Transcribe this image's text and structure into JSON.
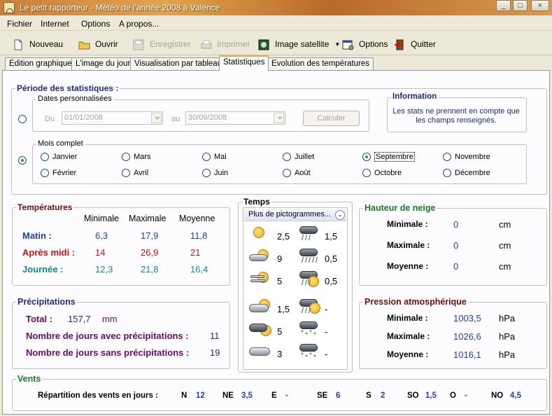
{
  "window": {
    "title": "Le petit rapporteur - Météo de l'année 2008 à Valence",
    "min": "_",
    "max": "□",
    "close": "×"
  },
  "menu": [
    "Fichier",
    "Internet",
    "Options",
    "A propos..."
  ],
  "toolbar": {
    "new": "Nouveau",
    "open": "Ouvrir",
    "save": "Enregistrer",
    "print": "Imprimer",
    "satellite": "Image satellite",
    "options": "Options",
    "quit": "Quitter"
  },
  "tabs": [
    "Edition graphique",
    "L'image du jour",
    "Visualisation par tableau",
    "Statistiques",
    "Evolution des températures"
  ],
  "period": {
    "title": "Période des statistiques :",
    "custom_title": "Dates personnalisées",
    "from_label": "Du",
    "from_value": "01/01/2008",
    "to_label": "au",
    "to_value": "30/09/2008",
    "compute": "Calculer",
    "month_title": "Mois complet",
    "months": [
      "Janvier",
      "Février",
      "Mars",
      "Avril",
      "Mai",
      "Juin",
      "Juillet",
      "Août",
      "Septembre",
      "Octobre",
      "Novembre",
      "Décembre"
    ],
    "selected_month": "Septembre"
  },
  "info": {
    "title": "Information",
    "text1": "Les stats ne prennent en compte que",
    "text2": "les champs renseignés."
  },
  "temps": {
    "title": "Températures",
    "cols": [
      "Minimale",
      "Maximale",
      "Moyenne"
    ],
    "rows": [
      {
        "label": "Matin :",
        "min": "6,3",
        "max": "17,9",
        "avg": "11,8",
        "color": "#1f3fb5"
      },
      {
        "label": "Après midi :",
        "min": "14",
        "max": "26,9",
        "avg": "21",
        "color": "#cc1111"
      },
      {
        "label": "Journée :",
        "min": "12,3",
        "max": "21,8",
        "avg": "16,4",
        "color": "#128a8a"
      }
    ]
  },
  "weather": {
    "title": "Temps",
    "dropdown": "Plus de pictogrammes...",
    "left": [
      {
        "icon": "sun-icon",
        "value": "2,5"
      },
      {
        "icon": "sun-cloud-icon",
        "value": "9"
      },
      {
        "icon": "sun-haze-icon",
        "value": "5"
      },
      {
        "icon": "partly-cloudy-icon",
        "value": "1,5"
      },
      {
        "icon": "cloudy-sun-icon",
        "value": "5"
      },
      {
        "icon": "overcast-icon",
        "value": "3"
      }
    ],
    "right": [
      {
        "icon": "rain-icon",
        "value": "1,5"
      },
      {
        "icon": "heavy-rain-icon",
        "value": "0,5"
      },
      {
        "icon": "storm-icon",
        "value": "0,5"
      },
      {
        "icon": "showers-sun-icon",
        "value": "-"
      },
      {
        "icon": "snow-sun-icon",
        "value": "-"
      },
      {
        "icon": "snow-icon",
        "value": "-"
      }
    ]
  },
  "snow": {
    "title": "Hauteur de neige",
    "rows": [
      {
        "label": "Minimale :",
        "value": "0",
        "unit": "cm"
      },
      {
        "label": "Maximale :",
        "value": "0",
        "unit": "cm"
      },
      {
        "label": "Moyenne :",
        "value": "0",
        "unit": "cm"
      }
    ]
  },
  "precip": {
    "title": "Précipitations",
    "total_label": "Total :",
    "total_value": "157,7",
    "total_unit": "mm",
    "with_label": "Nombre de jours avec précipitations :",
    "with_value": "11",
    "without_label": "Nombre de jours sans précipitations :",
    "without_value": "19"
  },
  "pressure": {
    "title": "Pression atmosphérique",
    "rows": [
      {
        "label": "Minimale :",
        "value": "1003,5",
        "unit": "hPa"
      },
      {
        "label": "Maximale :",
        "value": "1026,6",
        "unit": "hPa"
      },
      {
        "label": "Moyenne :",
        "value": "1016,1",
        "unit": "hPa"
      }
    ]
  },
  "winds": {
    "title": "Vents",
    "label": "Répartition des vents en jours :",
    "dirs": [
      {
        "dir": "N",
        "value": "12"
      },
      {
        "dir": "NE",
        "value": "3,5"
      },
      {
        "dir": "E",
        "value": "-"
      },
      {
        "dir": "SE",
        "value": "6"
      },
      {
        "dir": "S",
        "value": "2"
      },
      {
        "dir": "SO",
        "value": "1,5"
      },
      {
        "dir": "O",
        "value": "-"
      },
      {
        "dir": "NO",
        "value": "4,5"
      }
    ]
  },
  "colors": {
    "navy": "#1f2a8a",
    "blue": "#1f3fb5",
    "darkred": "#7a0d0d",
    "green": "#1a7a2a",
    "purple": "#6a0a6a"
  }
}
